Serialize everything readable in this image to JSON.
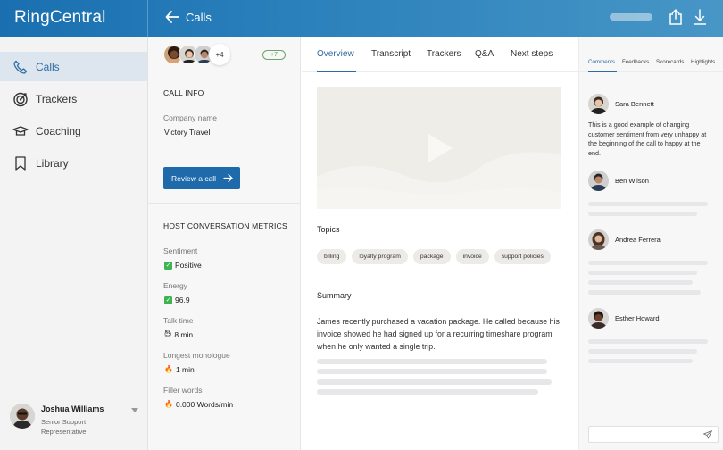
{
  "app": {
    "brand": "RingCentral",
    "page_title": "Calls",
    "accent_color": "#1f6aab"
  },
  "header": {
    "back_icon": "arrow-left-icon",
    "share_icon": "share-icon",
    "download_icon": "download-icon"
  },
  "sidebar": {
    "items": [
      {
        "label": "Calls",
        "icon": "phone-icon",
        "active": true
      },
      {
        "label": "Trackers",
        "icon": "target-icon",
        "active": false
      },
      {
        "label": "Coaching",
        "icon": "graduation-cap-icon",
        "active": false
      },
      {
        "label": "Library",
        "icon": "bookmark-icon",
        "active": false
      }
    ],
    "user": {
      "name": "Joshua Williams",
      "role": "Senior Support Representative"
    }
  },
  "call_info": {
    "participants_more": "+4",
    "badge": "+7",
    "section_title": "CALL INFO",
    "company_label": "Company name",
    "company_value": "Victory Travel",
    "review_button": "Review a call",
    "metrics_title": "HOST CONVERSATION METRICS",
    "metrics": [
      {
        "label": "Sentiment",
        "icon": "check-icon",
        "value": "Positive"
      },
      {
        "label": "Energy",
        "icon": "check-icon",
        "value": "96.9"
      },
      {
        "label": "Talk time",
        "icon": "devil-icon",
        "emoji": "😈",
        "value": "8 min"
      },
      {
        "label": "Longest monologue",
        "icon": "fire-icon",
        "emoji": "🔥",
        "value": "1 min"
      },
      {
        "label": "Filler words",
        "icon": "fire-icon",
        "emoji": "🔥",
        "value": "0.000 Words/min"
      }
    ]
  },
  "main": {
    "tabs": [
      {
        "label": "Overview",
        "active": true
      },
      {
        "label": "Transcript",
        "active": false
      },
      {
        "label": "Trackers",
        "active": false
      },
      {
        "label": "Q&A",
        "active": false
      },
      {
        "label": "Next steps",
        "active": false
      }
    ],
    "topics_title": "Topics",
    "topics": [
      "billing",
      "loyalty program",
      "package",
      "invoice",
      "support policies"
    ],
    "summary_title": "Summary",
    "summary_text": "James recently purchased a vacation package. He called because his invoice showed he had signed up for a recurring timeshare program when he only wanted a single trip."
  },
  "comments_panel": {
    "tabs": [
      {
        "label": "Comments",
        "active": true
      },
      {
        "label": "Feedbacks",
        "active": false
      },
      {
        "label": "Scorecards",
        "active": false
      },
      {
        "label": "Highlights",
        "active": false
      }
    ],
    "comments": [
      {
        "author": "Sara Bennett",
        "text": "This is a good example of changing customer sentiment from very unhappy at the beginning of the call to happy at the end."
      },
      {
        "author": "Ben Wilson",
        "text": ""
      },
      {
        "author": "Andrea Ferrera",
        "text": ""
      },
      {
        "author": "Esther Howard",
        "text": ""
      }
    ],
    "input_placeholder": ""
  }
}
